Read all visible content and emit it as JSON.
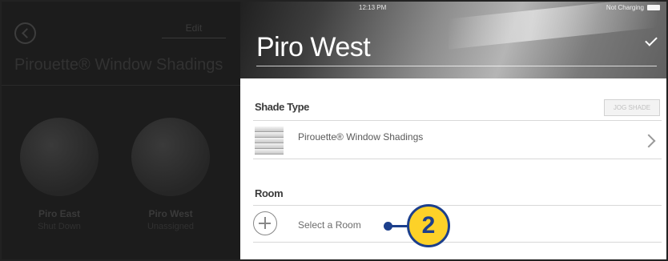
{
  "left_panel": {
    "action_label": "Edit",
    "title": "Pirouette® Window Shadings",
    "shades": [
      {
        "name": "Piro East",
        "status": "Shut Down"
      },
      {
        "name": "Piro West",
        "status": "Unassigned"
      }
    ]
  },
  "status_bar": {
    "time": "12:13 PM",
    "charge": "Not Charging"
  },
  "header": {
    "title": "Piro West",
    "confirm_icon": "check-icon"
  },
  "shade_type": {
    "label": "Shade Type",
    "jog_button": "JOG SHADE",
    "value": "Pirouette® Window Shadings"
  },
  "room": {
    "label": "Room",
    "placeholder": "Select a Room"
  },
  "callout": {
    "number": "2",
    "colors": {
      "fill": "#fdd128",
      "stroke": "#1c3f8c"
    }
  }
}
